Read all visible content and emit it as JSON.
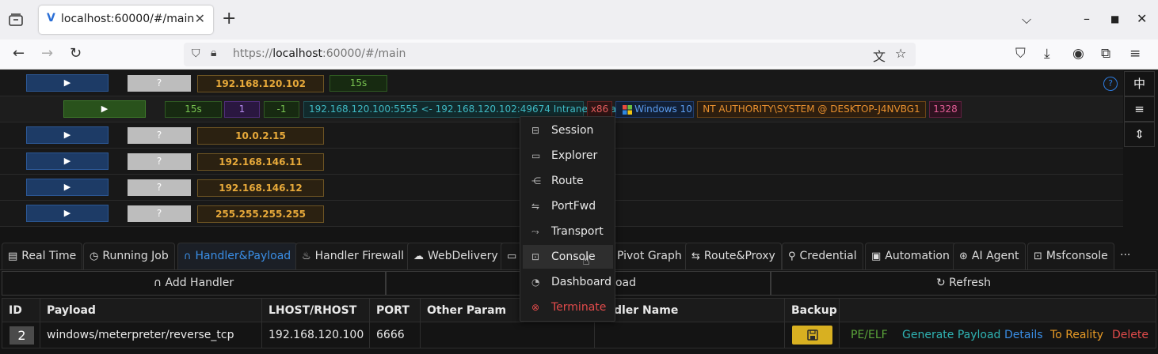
{
  "browser": {
    "tab_title": "localhost:60000/#/main",
    "tab_favicon": "V",
    "url_host_prefix": "https://",
    "url_host": "localhost",
    "url_rest": ":60000/#/main",
    "icons": [
      "tab-list-icon",
      "new-tab-icon",
      "list-all-tabs-icon",
      "minimize-icon",
      "maximize-icon",
      "close-window-icon",
      "back-icon",
      "forward-icon",
      "reload-icon",
      "shield-icon",
      "lock-icon",
      "translate-icon",
      "bookmark-star-icon",
      "pocket-icon",
      "downloads-icon",
      "account-icon",
      "extensions-icon",
      "menu-icon"
    ]
  },
  "sessions": [
    {
      "q": "?",
      "ip": "192.168.120.102",
      "age": "15s"
    },
    {
      "q": "?",
      "ip": "10.0.2.15"
    },
    {
      "q": "?",
      "ip": "192.168.146.11"
    },
    {
      "q": "?",
      "ip": "192.168.146.12"
    },
    {
      "q": "?",
      "ip": "255.255.255.255"
    }
  ],
  "session_detail": {
    "age": "15s",
    "count": "1",
    "neg": "-1",
    "conn": "192.168.120.100:5555 <- 192.168.120.102:49674 Intranet Local",
    "arch": "x86",
    "os": "Windows 10",
    "user": "NT AUTHORITY\\SYSTEM @ DESKTOP-J4NVBG1",
    "pid": "1328"
  },
  "side_buttons": [
    "中",
    "≡",
    "⇕"
  ],
  "help": "?",
  "tabs": [
    {
      "label": "Real Time"
    },
    {
      "label": "Running Job"
    },
    {
      "label": "Handler&Payload"
    },
    {
      "label": "Handler Firewall"
    },
    {
      "label": "WebDelivery"
    },
    {
      "label": "Pivot Graph"
    },
    {
      "label": "Route&Proxy"
    },
    {
      "label": "Credential"
    },
    {
      "label": "Automation"
    },
    {
      "label": "AI Agent"
    },
    {
      "label": "Msfconsole"
    },
    {
      "label": "···"
    }
  ],
  "actions": {
    "add_handler": "Add Handler",
    "middle": "oad",
    "refresh": "Refresh"
  },
  "table": {
    "headers": [
      "ID",
      "Payload",
      "LHOST/RHOST",
      "PORT",
      "Other Param",
      "ndler Name",
      "Backup"
    ],
    "row": {
      "id": "2",
      "payload": "windows/meterpreter/reverse_tcp",
      "lhost": "192.168.120.100",
      "port": "6666",
      "links": [
        "PE/ELF",
        "Generate Payload",
        "Details",
        "To Reality",
        "Delete"
      ]
    }
  },
  "menu": {
    "items": [
      {
        "label": "Session",
        "icon": "session-icon"
      },
      {
        "label": "Explorer",
        "icon": "monitor-icon"
      },
      {
        "label": "Route",
        "icon": "route-icon"
      },
      {
        "label": "PortFwd",
        "icon": "port-forward-icon"
      },
      {
        "label": "Transport",
        "icon": "transport-icon"
      },
      {
        "label": "Console",
        "icon": "console-icon"
      },
      {
        "label": "Dashboard",
        "icon": "dashboard-icon"
      },
      {
        "label": "Terminate",
        "icon": "terminate-icon"
      }
    ],
    "hovered": "Console"
  },
  "colors": {
    "accent": "#3a8ee6",
    "ip_text": "#e7a93a",
    "danger": "#e24b4b",
    "save": "#d8b021"
  }
}
